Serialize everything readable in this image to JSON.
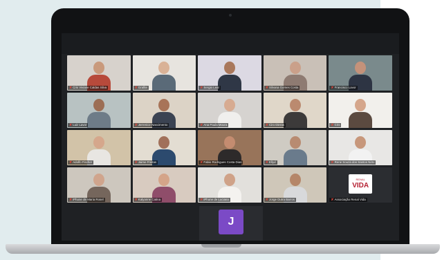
{
  "avatar_initial": "J",
  "brand": {
    "top": "RENAL",
    "main": "VIDA"
  },
  "participants": [
    {
      "name": "Cris Viviane Caldas Silva",
      "bg": "#d7d2cc",
      "skin": "#c99a7c",
      "shirt": "#b74a3b"
    },
    {
      "name": "Grafite",
      "bg": "#e7e4df",
      "skin": "#d9b297",
      "shirt": "#5a6a78"
    },
    {
      "name": "Sergio Leal",
      "bg": "#dcd9e3",
      "skin": "#a9785c",
      "shirt": "#2f3746"
    },
    {
      "name": "Silvana Gomes Costa",
      "bg": "#c9c0b7",
      "skin": "#caa08a",
      "shirt": "#8e7b72"
    },
    {
      "name": "Francisco Lavor",
      "bg": "#7a8a8c",
      "skin": "#c4927a",
      "shirt": "#2d3443",
      "active": true
    },
    {
      "name": "Luiz Lavor",
      "bg": "#b8c2c2",
      "skin": "#9c6e55",
      "shirt": "#6e7c88"
    },
    {
      "name": "Jerrenice Nascimento",
      "bg": "#dcd3c6",
      "skin": "#a87458",
      "shirt": "#3b4352"
    },
    {
      "name": "Ana Paula Moura",
      "bg": "#d6d3d0",
      "skin": "#d7ab91",
      "shirt": "#f0efed"
    },
    {
      "name": "Ciro Dieras",
      "bg": "#e0d7c9",
      "skin": "#bb8a6f",
      "shirt": "#3c3a3a"
    },
    {
      "name": "Cris",
      "bg": "#f2f0ec",
      "skin": "#d5a68b",
      "shirt": "#5b4a40"
    },
    {
      "name": "Adolfo Fischer",
      "bg": "#d2c3a8",
      "skin": "#d5a78c",
      "shirt": "#e8e6e2"
    },
    {
      "name": "Jaime Freitas",
      "bg": "#e3ddd2",
      "skin": "#a1705a",
      "shirt": "#2c4a6e"
    },
    {
      "name": "Fabio Rodrigues Costa Dias",
      "bg": "#98745a",
      "skin": "#c48c70",
      "shirt": "#2d2a2a"
    },
    {
      "name": "Ellyd",
      "bg": "#cfcbc3",
      "skin": "#b88b71",
      "shirt": "#6a7b8c"
    },
    {
      "name": "Rene Souza dos Santos Neto",
      "bg": "#e8e7e5",
      "skin": "#c7977b",
      "shirt": "#f2f2f2"
    },
    {
      "name": "iPhone de Maria Rosel",
      "bg": "#cdc7be",
      "skin": "#d0a58d",
      "shirt": "#75665c"
    },
    {
      "name": "Kalyanne Catina",
      "bg": "#d8cbc0",
      "skin": "#d4a489",
      "shirt": "#8f4d6a"
    },
    {
      "name": "iPhone de Luciana",
      "bg": "#e2e0dc",
      "skin": "#cfa288",
      "shirt": "#f4f2ef"
    },
    {
      "name": "Jorge Dutra Barros",
      "bg": "#cfc7b9",
      "skin": "#b58669",
      "shirt": "#d8d9db"
    },
    {
      "name": "Associação Renal Vida",
      "bg": "#2b2d31",
      "logo": true
    }
  ]
}
